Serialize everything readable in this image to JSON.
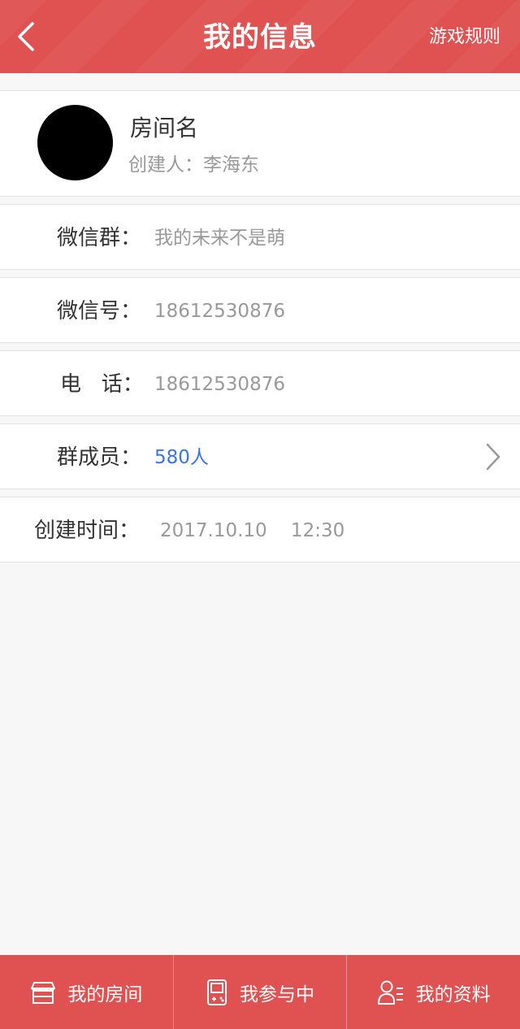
{
  "header": {
    "title": "我的信息",
    "rules_label": "游戏规则",
    "back_icon": "chevron-left-icon"
  },
  "room": {
    "name": "房间名",
    "creator": "创建人：李海东"
  },
  "info": {
    "wechat_group": {
      "label": "微信群：",
      "value": "我的未来不是萌"
    },
    "wechat_id": {
      "label": "微信号：",
      "value": "18612530876"
    },
    "phone": {
      "label": "电   话：",
      "value": "18612530876"
    },
    "members": {
      "label": "群成员：",
      "value": "580人"
    },
    "created": {
      "label": "创建时间：",
      "value": "2017.10.10    12:30"
    }
  },
  "tabs": [
    {
      "label": "我的房间",
      "icon": "store-icon"
    },
    {
      "label": "我参与中",
      "icon": "gamepad-icon"
    },
    {
      "label": "我的资料",
      "icon": "user-profile-icon"
    }
  ],
  "colors": {
    "brand_red": "#e05151",
    "link_blue": "#3a73e8",
    "value_gray": "#999999",
    "label_dark": "#333333"
  }
}
